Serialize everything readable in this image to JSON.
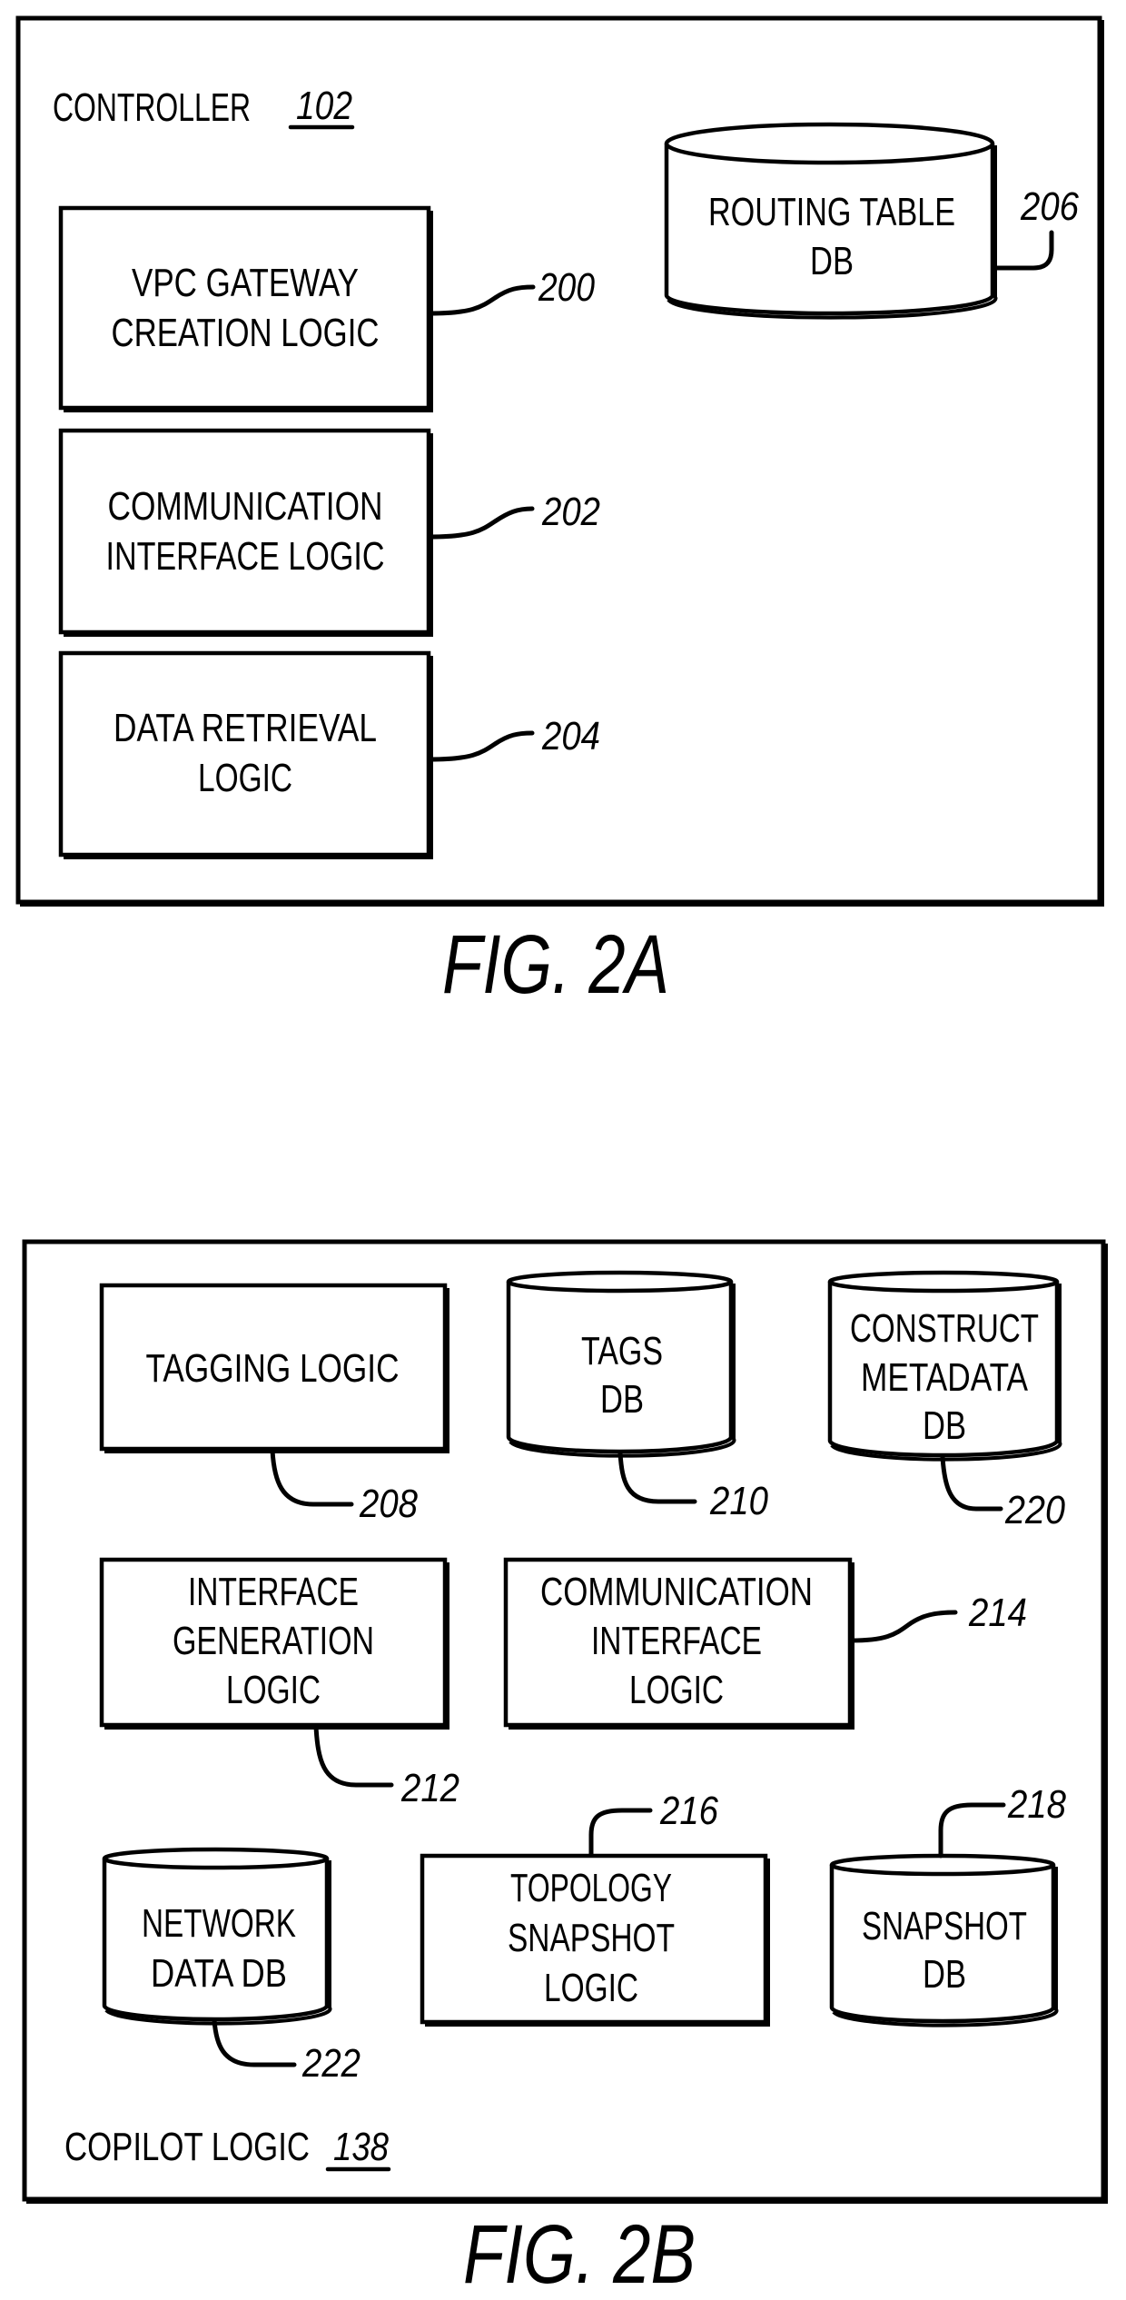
{
  "figures": {
    "fig2a": {
      "caption": "FIG. 2A",
      "container": {
        "label": "CONTROLLER",
        "ref": "102"
      },
      "components": {
        "vpc_gateway": {
          "lines": [
            "VPC GATEWAY",
            "CREATION LOGIC"
          ],
          "ref": "200",
          "shape": "box"
        },
        "comm_interface": {
          "lines": [
            "COMMUNICATION",
            "INTERFACE LOGIC"
          ],
          "ref": "202",
          "shape": "box"
        },
        "data_retrieval": {
          "lines": [
            "DATA RETRIEVAL",
            "LOGIC"
          ],
          "ref": "204",
          "shape": "box"
        },
        "routing_table_db": {
          "lines": [
            "ROUTING TABLE",
            "DB"
          ],
          "ref": "206",
          "shape": "database"
        }
      }
    },
    "fig2b": {
      "caption": "FIG. 2B",
      "container": {
        "label": "COPILOT LOGIC",
        "ref": "138"
      },
      "components": {
        "tagging": {
          "lines": [
            "TAGGING LOGIC"
          ],
          "ref": "208",
          "shape": "box"
        },
        "tags_db": {
          "lines": [
            "TAGS",
            "DB"
          ],
          "ref": "210",
          "shape": "database"
        },
        "construct_metadata_db": {
          "lines": [
            "CONSTRUCT",
            "METADATA",
            "DB"
          ],
          "ref": "220",
          "shape": "database"
        },
        "interface_generation": {
          "lines": [
            "INTERFACE",
            "GENERATION",
            "LOGIC"
          ],
          "ref": "212",
          "shape": "box"
        },
        "comm_interface": {
          "lines": [
            "COMMUNICATION",
            "INTERFACE",
            "LOGIC"
          ],
          "ref": "214",
          "shape": "box"
        },
        "network_data_db": {
          "lines": [
            "NETWORK",
            "DATA DB"
          ],
          "ref": "222",
          "shape": "database"
        },
        "topology_snapshot": {
          "lines": [
            "TOPOLOGY",
            "SNAPSHOT",
            "LOGIC"
          ],
          "ref": "216",
          "shape": "box"
        },
        "snapshot_db": {
          "lines": [
            "SNAPSHOT",
            "DB"
          ],
          "ref": "218",
          "shape": "database"
        }
      }
    }
  },
  "colors": {
    "ink": "#000000",
    "paper": "#ffffff"
  }
}
